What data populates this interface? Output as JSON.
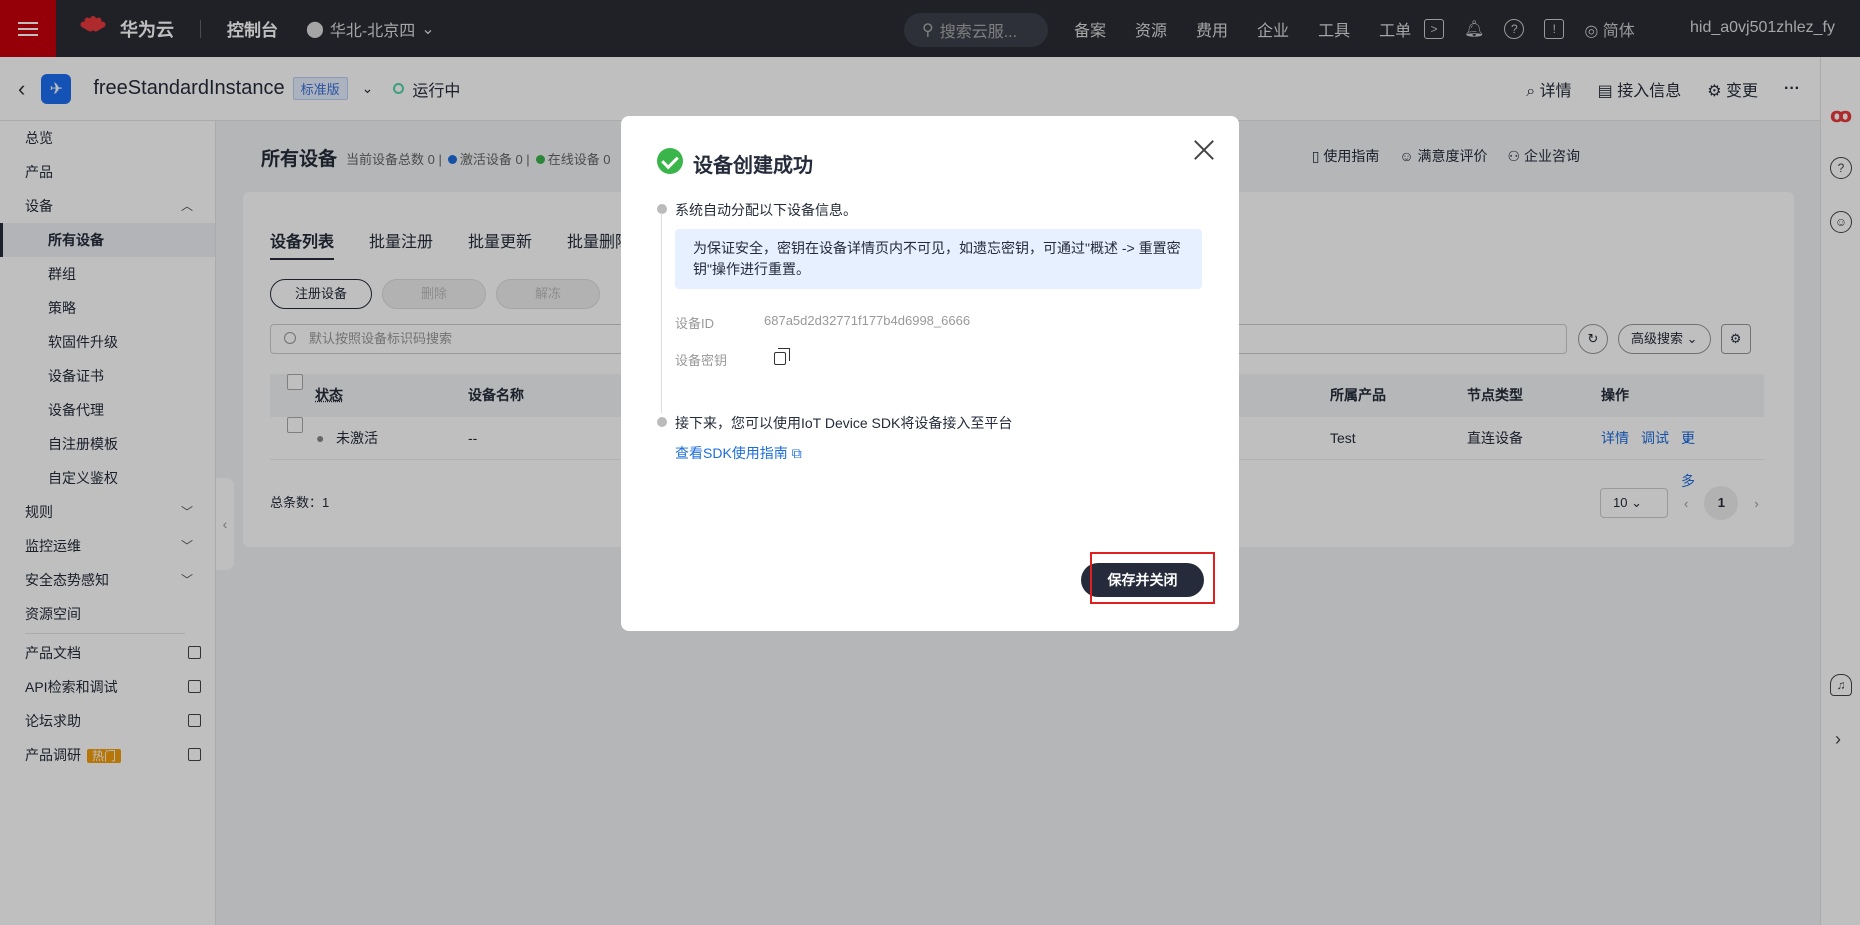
{
  "topbar": {
    "brand": "华为云",
    "brand_small": "HUAWEI",
    "console": "控制台",
    "region": "华北-北京四",
    "search_placeholder": "搜索云服...",
    "links": [
      "备案",
      "资源",
      "费用",
      "企业",
      "工具",
      "工单"
    ],
    "lang": "简体",
    "user": "hid_a0vj501zhlez_fy"
  },
  "instance": {
    "name": "freeStandardInstance",
    "edition": "标准版",
    "status": "运行中",
    "actions": [
      "详情",
      "接入信息",
      "变更"
    ]
  },
  "sidebar": {
    "items": [
      {
        "label": "总览"
      },
      {
        "label": "产品"
      },
      {
        "label": "设备"
      },
      {
        "label": "所有设备"
      },
      {
        "label": "群组"
      },
      {
        "label": "策略"
      },
      {
        "label": "软固件升级"
      },
      {
        "label": "设备证书"
      },
      {
        "label": "设备代理"
      },
      {
        "label": "自注册模板"
      },
      {
        "label": "自定义鉴权"
      },
      {
        "label": "规则"
      },
      {
        "label": "监控运维"
      },
      {
        "label": "安全态势感知"
      },
      {
        "label": "资源空间"
      },
      {
        "label": "产品文档"
      },
      {
        "label": "API检索和调试"
      },
      {
        "label": "论坛求助"
      },
      {
        "label": "产品调研"
      }
    ],
    "hot_badge": "热门"
  },
  "main": {
    "title": "所有设备",
    "count_total": "当前设备总数 0",
    "count_active": "激活设备 0",
    "count_online": "在线设备 0",
    "links": [
      "使用指南",
      "满意度评价",
      "企业咨询"
    ],
    "tabs": [
      "设备列表",
      "批量注册",
      "批量更新",
      "批量删除"
    ],
    "buttons": {
      "register": "注册设备",
      "delete": "删除",
      "unfreeze": "解冻"
    },
    "search_placeholder": "默认按照设备标识码搜索",
    "advanced_search": "高级搜索",
    "columns": {
      "status": "状态",
      "name": "设备名称",
      "product": "所属产品",
      "node": "节点类型",
      "ops": "操作"
    },
    "row": {
      "status": "未激活",
      "name": "--",
      "product": "Test",
      "node": "直连设备",
      "detail": "详情",
      "debug": "调试",
      "more": "更多"
    },
    "total": "总条数：1",
    "page_size": "10",
    "page_current": "1"
  },
  "dialog": {
    "title": "设备创建成功",
    "step1": "系统自动分配以下设备信息。",
    "note": "为保证安全，密钥在设备详情页内不可见，如遗忘密钥，可通过\"概述 -> 重置密钥\"操作进行重置。",
    "device_id_label": "设备ID",
    "device_id_value": "687a5d2d32771f177b4d6998_6666",
    "secret_label": "设备密钥",
    "step2": "接下来，您可以使用IoT Device SDK将设备接入至平台",
    "sdk_link": "查看SDK使用指南",
    "save_button": "保存并关闭"
  },
  "colors": {
    "brand_red": "#c7000b",
    "success": "#3ab54a",
    "link": "#1c6dde",
    "highlight": "#e02020"
  }
}
